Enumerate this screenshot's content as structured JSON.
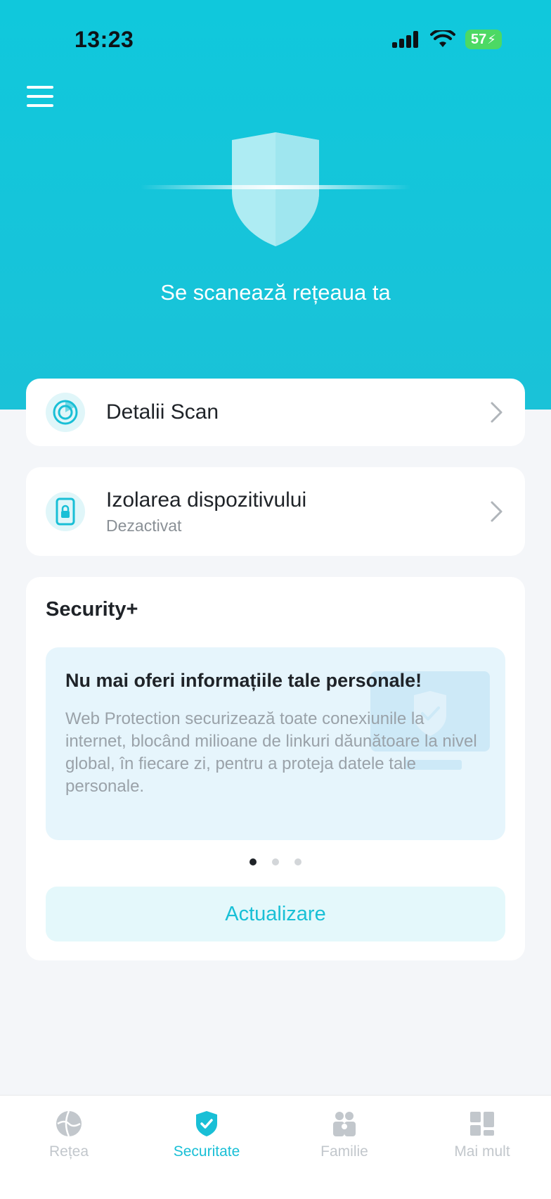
{
  "status_bar": {
    "time": "13:23",
    "battery": "57"
  },
  "hero": {
    "title": "Se scanează rețeaua ta"
  },
  "cards": {
    "scan_details": {
      "label": "Detalii Scan"
    },
    "device_isolation": {
      "label": "Izolarea dispozitivului",
      "status": "Dezactivat"
    }
  },
  "security_plus": {
    "title": "Security+",
    "promo": {
      "heading": "Nu mai oferi informațiile tale personale!",
      "body": "Web Protection securizează toate conexiunile la internet, blocând milioane de linkuri dăunătoare la nivel global, în fiecare zi, pentru a proteja datele tale personale."
    },
    "carousel": {
      "count": 3,
      "active": 1
    },
    "upgrade_label": "Actualizare"
  },
  "tabs": [
    {
      "label": "Rețea",
      "icon": "network-globe-icon",
      "active": false
    },
    {
      "label": "Securitate",
      "icon": "shield-check-icon",
      "active": true
    },
    {
      "label": "Familie",
      "icon": "family-icon",
      "active": false
    },
    {
      "label": "Mai mult",
      "icon": "more-grid-icon",
      "active": false
    }
  ],
  "colors": {
    "accent": "#19bfd6",
    "hero_bg": "#10c8dc",
    "page_bg": "#f4f6f9",
    "inactive_tab": "#c2c7cc"
  }
}
